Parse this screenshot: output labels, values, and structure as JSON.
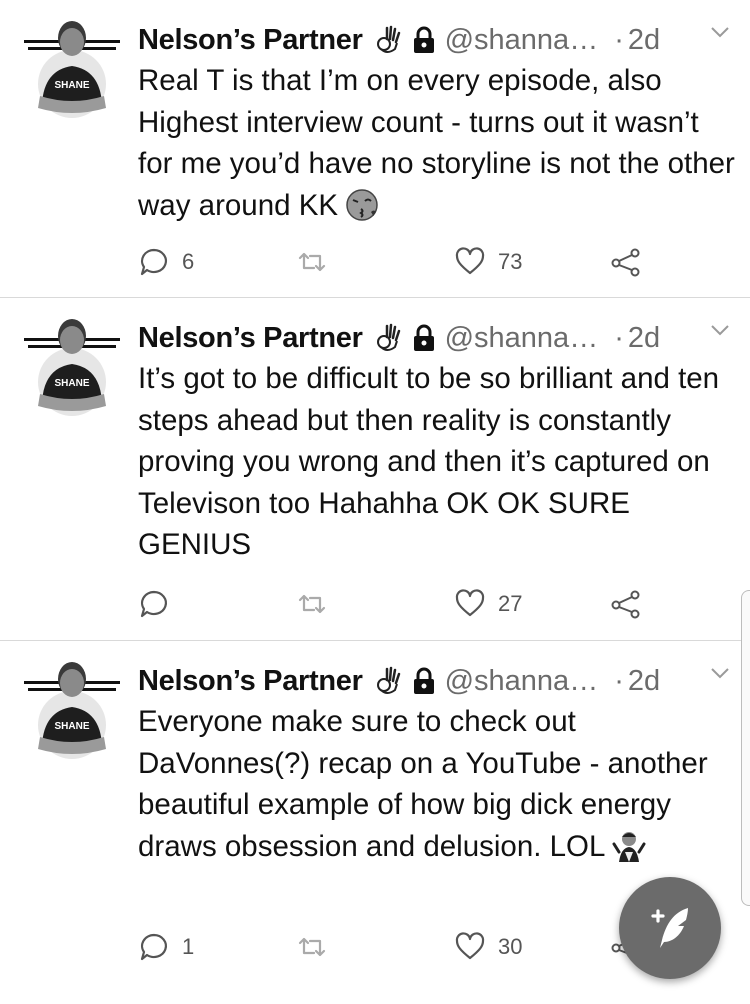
{
  "tweets": [
    {
      "author_name": "Nelson’s Partner",
      "handle": "@shanna…",
      "separator": "·",
      "time": "2d",
      "avatar_label": "SHANE",
      "text": "Real T is that I’m on every episode, also Highest interview count -  turns out it wasn’t for me you’d have no storyline is not the other way around KK",
      "text_emoji": "face-blowing-kiss",
      "reply_count": "6",
      "retweet_count": "",
      "like_count": "73"
    },
    {
      "author_name": "Nelson’s Partner",
      "handle": "@shanna…",
      "separator": "·",
      "time": "2d",
      "avatar_label": "SHANE",
      "text": "It’s got to be difficult to be so brilliant and ten steps ahead but then reality is constantly proving you wrong and then it’s captured on Televison too Hahahha OK OK SURE GENIUS",
      "text_emoji": "",
      "reply_count": "",
      "retweet_count": "",
      "like_count": "27"
    },
    {
      "author_name": "Nelson’s Partner",
      "handle": "@shanna…",
      "separator": "·",
      "time": "2d",
      "avatar_label": "SHANE",
      "text": "Everyone make sure to check out DaVonnes(?) recap on a YouTube - another beautiful example of how big dick energy draws obsession and delusion. LOL",
      "text_emoji": "person-shrugging",
      "reply_count": "1",
      "retweet_count": "",
      "like_count": "30"
    }
  ],
  "icons": {
    "ok_hand": "ok-hand-emoji",
    "lock": "lock-icon",
    "caret": "chevron-down-icon",
    "reply": "reply-icon",
    "retweet": "retweet-icon",
    "like": "heart-icon",
    "share": "share-icon",
    "compose": "compose-tweet-icon"
  },
  "colors": {
    "text": "#111111",
    "secondary": "#6b6b6b",
    "fab": "#6b6b6b",
    "divider": "#d9d9d9"
  }
}
